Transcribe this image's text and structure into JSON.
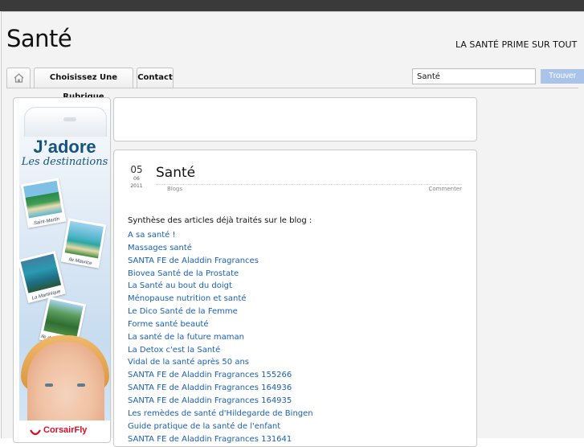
{
  "site": {
    "title": "Santé",
    "tagline": "LA SANTÉ PRIME SUR TOUT"
  },
  "nav": {
    "home_icon": "home-icon",
    "tabs": [
      "Choisissez Une Rubrique",
      "Contact"
    ]
  },
  "search": {
    "value": "Santé",
    "button_label": "Trouver"
  },
  "ad": {
    "title": "J’adore",
    "subtitle": "Les destinations",
    "photos": [
      "Saint-Martin",
      "Ile Maurice",
      "La Martinique",
      "Ile de la Réunion"
    ],
    "brand": "CorsairFly"
  },
  "post": {
    "day": "05",
    "month": "06",
    "year": "2011",
    "title": "Santé",
    "category": "Blogs",
    "comment_link": "Commenter",
    "intro": "Synthèse des articles déjà traités sur le blog :",
    "articles": [
      "A sa santé !",
      "Massages santé",
      "SANTA FE de Aladdin Fragrances",
      "Biovea Santé de la Prostate",
      "La Santé au bout du doigt",
      "Ménopause nutrition et santé",
      "Le Dico Santé de la Femme",
      "Forme santé beauté",
      "La santé de la future maman",
      "La Detox c'est la Santé",
      "Vidal de la santé après 50 ans",
      "SANTA FE de Aladdin Fragrances 155266",
      "SANTA FE de Aladdin Fragrances 164936",
      "SANTA FE de Aladdin Fragrances 164935",
      "Les remèdes de santé d'Hildegarde de Bingen",
      "Guide pratique de la santé de l'enfant",
      "SANTA FE de Aladdin Fragrances 131641"
    ]
  }
}
